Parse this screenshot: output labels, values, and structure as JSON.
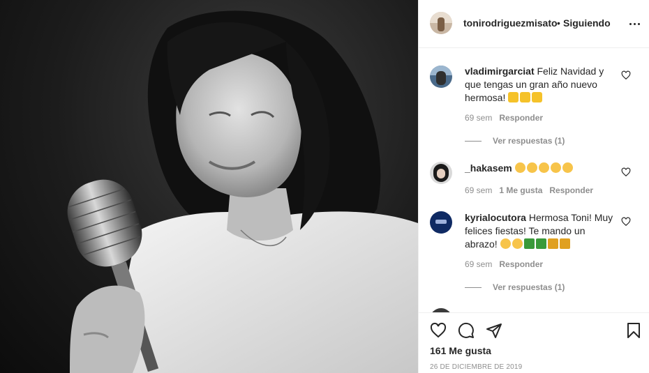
{
  "post": {
    "photo_description_icon": "photo-icon",
    "author": {
      "username": "tonirodriguezmisato",
      "separator": "•",
      "follow_status": "Siguiendo"
    },
    "comments": [
      {
        "username": "vladimirgarciat",
        "text": "Feliz Navidad y que tengas un gran año nuevo hermosa!",
        "emojis": [
          "star",
          "star",
          "star"
        ],
        "time": "69 sem",
        "reply_label": "Responder",
        "view_replies": "Ver respuestas (1)"
      },
      {
        "username": "_hakasem",
        "text": "",
        "emojis": [
          "heart-eyes",
          "heart-eyes",
          "heart-eyes",
          "heart-eyes",
          "heart-eyes"
        ],
        "time": "69 sem",
        "likes": "1 Me gusta",
        "reply_label": "Responder"
      },
      {
        "username": "kyrialocutora",
        "text": "Hermosa Toni! Muy felices fiestas! Te mando un abrazo!",
        "emojis": [
          "hug",
          "hug",
          "tree",
          "tree",
          "party",
          "party"
        ],
        "time": "69 sem",
        "reply_label": "Responder",
        "view_replies": "Ver respuestas (1)"
      }
    ],
    "like_count": "161 Me gusta",
    "date": "26 DE DICIEMBRE DE 2019",
    "icons": {
      "like": "heart-icon",
      "comment": "comment-icon",
      "share": "paper-plane-icon",
      "save": "bookmark-icon",
      "options": "more-options-icon"
    }
  },
  "colors": {
    "text": "#262626",
    "secondary": "#8e8e8e",
    "border": "#efefef"
  }
}
